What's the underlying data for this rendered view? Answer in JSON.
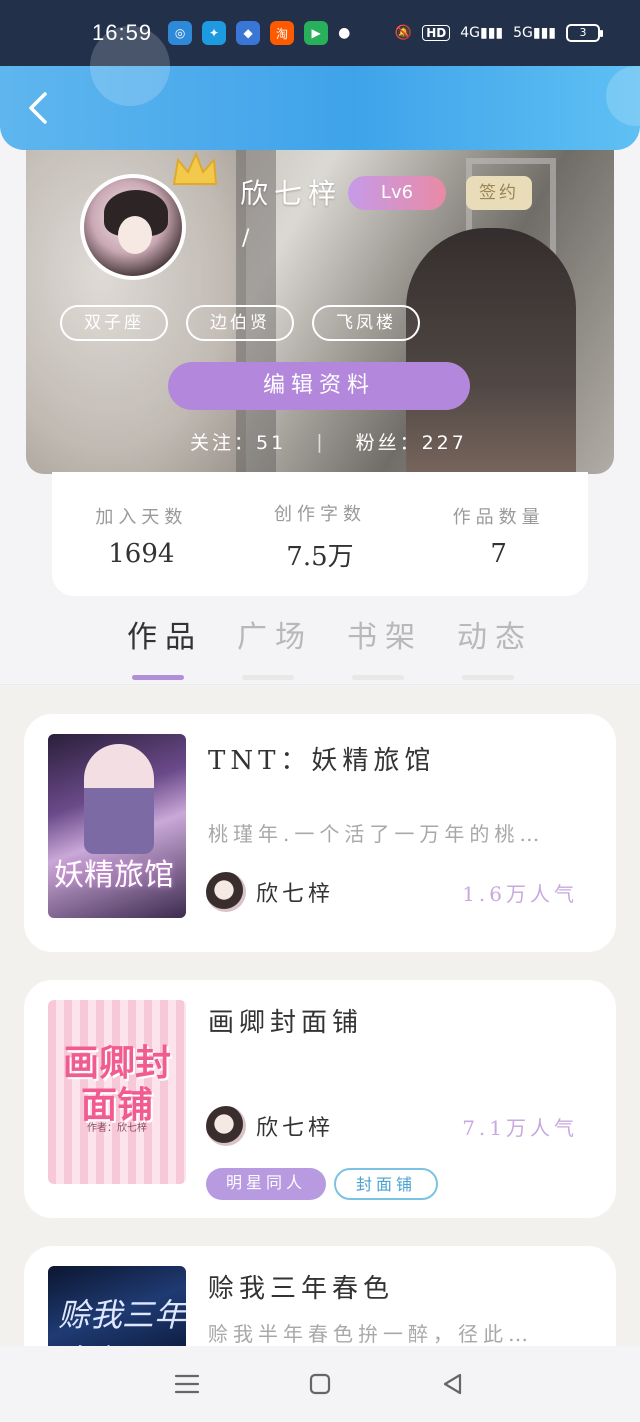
{
  "status_bar": {
    "time": "16:59",
    "apps": [
      "app-icon-1",
      "app-icon-2",
      "app-icon-3",
      "taobao-icon",
      "app-icon-5"
    ],
    "network_labels": [
      "HD",
      "4G",
      "5G"
    ],
    "battery": "3"
  },
  "header": {
    "back_icon": "chevron-left-icon"
  },
  "profile": {
    "nickname": "欣七梓",
    "level": "Lv6",
    "signed": "签约",
    "slash": "/",
    "tags": [
      "双子座",
      "边伯贤",
      "飞凤楼"
    ],
    "edit_label": "编辑资料",
    "follow_label": "关注：51",
    "fans_label": "粉丝：227"
  },
  "stats": [
    {
      "label": "加入天数",
      "value": "1694"
    },
    {
      "label": "创作字数",
      "value": "7.5万"
    },
    {
      "label": "作品数量",
      "value": "7"
    }
  ],
  "tabs": [
    {
      "label": "作品",
      "active": true
    },
    {
      "label": "广场",
      "active": false
    },
    {
      "label": "书架",
      "active": false
    },
    {
      "label": "动态",
      "active": false
    }
  ],
  "works": [
    {
      "title": "TNT：妖精旅馆",
      "desc": "桃瑾年.一个活了一万年的桃…",
      "cover_text": "妖精旅馆",
      "author": "欣七梓",
      "popularity": "1.6万人气",
      "chips": []
    },
    {
      "title": "画卿封面铺",
      "desc": "",
      "cover_text": "画卿封面铺",
      "cover_sub": "作者：欣七梓",
      "author": "欣七梓",
      "popularity": "7.1万人气",
      "chips": [
        "明星同人",
        "封面铺"
      ]
    },
    {
      "title": "赊我三年春色",
      "desc": "赊我半年春色拚一醉，径此…",
      "cover_text": "赊我三年春色",
      "author": "",
      "popularity": "",
      "chips": []
    }
  ],
  "nav": [
    "menu-icon",
    "home-square-icon",
    "back-triangle-icon"
  ]
}
